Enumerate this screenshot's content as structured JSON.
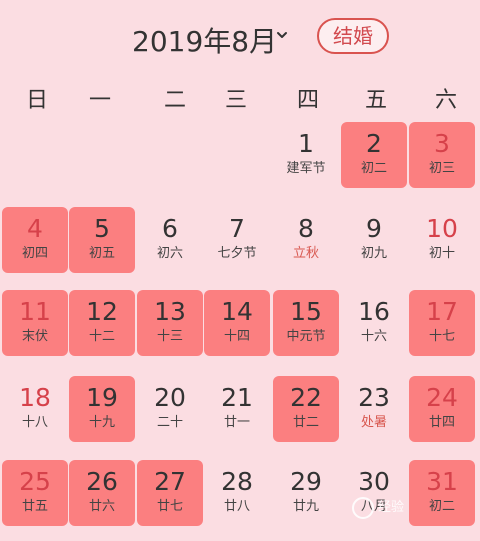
{
  "header": {
    "title": "2019年8月",
    "tag": "结婚"
  },
  "weekdays": [
    "日",
    "一",
    "二",
    "三",
    "四",
    "五",
    "六"
  ],
  "days": [
    {
      "day": "1",
      "sub": "建军节",
      "col": 4,
      "row": 0,
      "hl": false,
      "red": false,
      "subred": false
    },
    {
      "day": "2",
      "sub": "初二",
      "col": 5,
      "row": 0,
      "hl": true,
      "red": false,
      "subred": false
    },
    {
      "day": "3",
      "sub": "初三",
      "col": 6,
      "row": 0,
      "hl": true,
      "red": true,
      "subred": false
    },
    {
      "day": "4",
      "sub": "初四",
      "col": 0,
      "row": 1,
      "hl": true,
      "red": true,
      "subred": false
    },
    {
      "day": "5",
      "sub": "初五",
      "col": 1,
      "row": 1,
      "hl": true,
      "red": false,
      "subred": false
    },
    {
      "day": "6",
      "sub": "初六",
      "col": 2,
      "row": 1,
      "hl": false,
      "red": false,
      "subred": false
    },
    {
      "day": "7",
      "sub": "七夕节",
      "col": 3,
      "row": 1,
      "hl": false,
      "red": false,
      "subred": false
    },
    {
      "day": "8",
      "sub": "立秋",
      "col": 4,
      "row": 1,
      "hl": false,
      "red": false,
      "subred": true
    },
    {
      "day": "9",
      "sub": "初九",
      "col": 5,
      "row": 1,
      "hl": false,
      "red": false,
      "subred": false
    },
    {
      "day": "10",
      "sub": "初十",
      "col": 6,
      "row": 1,
      "hl": false,
      "red": true,
      "subred": false
    },
    {
      "day": "11",
      "sub": "末伏",
      "col": 0,
      "row": 2,
      "hl": true,
      "red": true,
      "subred": false
    },
    {
      "day": "12",
      "sub": "十二",
      "col": 1,
      "row": 2,
      "hl": true,
      "red": false,
      "subred": false
    },
    {
      "day": "13",
      "sub": "十三",
      "col": 2,
      "row": 2,
      "hl": true,
      "red": false,
      "subred": false
    },
    {
      "day": "14",
      "sub": "十四",
      "col": 3,
      "row": 2,
      "hl": true,
      "red": false,
      "subred": false
    },
    {
      "day": "15",
      "sub": "中元节",
      "col": 4,
      "row": 2,
      "hl": true,
      "red": false,
      "subred": false
    },
    {
      "day": "16",
      "sub": "十六",
      "col": 5,
      "row": 2,
      "hl": false,
      "red": false,
      "subred": false
    },
    {
      "day": "17",
      "sub": "十七",
      "col": 6,
      "row": 2,
      "hl": true,
      "red": true,
      "subred": false
    },
    {
      "day": "18",
      "sub": "十八",
      "col": 0,
      "row": 3,
      "hl": false,
      "red": true,
      "subred": false
    },
    {
      "day": "19",
      "sub": "十九",
      "col": 1,
      "row": 3,
      "hl": true,
      "red": false,
      "subred": false
    },
    {
      "day": "20",
      "sub": "二十",
      "col": 2,
      "row": 3,
      "hl": false,
      "red": false,
      "subred": false
    },
    {
      "day": "21",
      "sub": "廿一",
      "col": 3,
      "row": 3,
      "hl": false,
      "red": false,
      "subred": false
    },
    {
      "day": "22",
      "sub": "廿二",
      "col": 4,
      "row": 3,
      "hl": true,
      "red": false,
      "subred": false
    },
    {
      "day": "23",
      "sub": "处暑",
      "col": 5,
      "row": 3,
      "hl": false,
      "red": false,
      "subred": true
    },
    {
      "day": "24",
      "sub": "廿四",
      "col": 6,
      "row": 3,
      "hl": true,
      "red": true,
      "subred": false
    },
    {
      "day": "25",
      "sub": "廿五",
      "col": 0,
      "row": 4,
      "hl": true,
      "red": true,
      "subred": false
    },
    {
      "day": "26",
      "sub": "廿六",
      "col": 1,
      "row": 4,
      "hl": true,
      "red": false,
      "subred": false
    },
    {
      "day": "27",
      "sub": "廿七",
      "col": 2,
      "row": 4,
      "hl": true,
      "red": false,
      "subred": false
    },
    {
      "day": "28",
      "sub": "廿八",
      "col": 3,
      "row": 4,
      "hl": false,
      "red": false,
      "subred": false
    },
    {
      "day": "29",
      "sub": "廿九",
      "col": 4,
      "row": 4,
      "hl": false,
      "red": false,
      "subred": false
    },
    {
      "day": "30",
      "sub": "八月",
      "col": 5,
      "row": 4,
      "hl": false,
      "red": false,
      "subred": false
    },
    {
      "day": "31",
      "sub": "初二",
      "col": 6,
      "row": 4,
      "hl": true,
      "red": true,
      "subred": false
    }
  ],
  "watermark": "经验"
}
